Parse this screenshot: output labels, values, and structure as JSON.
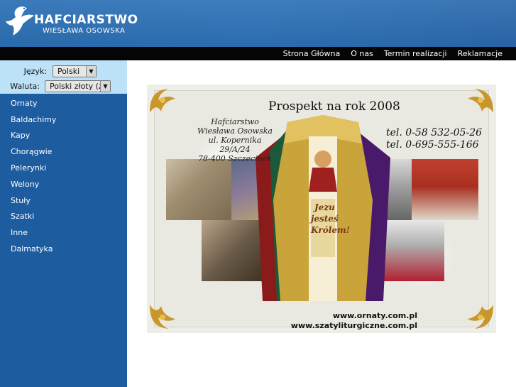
{
  "header": {
    "logo_line1": "HAFCIARSTWO",
    "logo_line2": "WIESŁAWA OSOWSKA"
  },
  "topnav": {
    "items": [
      "Strona Główna",
      "O nas",
      "Termin realizacji",
      "Reklamacje"
    ]
  },
  "controls": {
    "language_label": "Język:",
    "language_value": "Polski",
    "currency_label": "Waluta:",
    "currency_value": "Polski złoty (zł)"
  },
  "menu": {
    "items": [
      "Ornaty",
      "Baldachimy",
      "Kapy",
      "Chorągwie",
      "Pelerynki",
      "Welony",
      "Stuły",
      "Szatki",
      "Inne",
      "Dalmatyka"
    ]
  },
  "brochure": {
    "title": "Prospekt na rok 2008",
    "company_line1": "Hafciarstwo",
    "company_line2": "Wiesława Osowska",
    "company_line3": "ul. Kopernika 29/A/24",
    "company_line4": "78-400 Szczecinek",
    "phone1": "tel. 0-58 532-05-26",
    "phone2": "tel. 0-695-555-166",
    "vestment_text1": "Jezu",
    "vestment_text2": "jesteś",
    "vestment_text3": "Królem!",
    "url1": "www.ornaty.com.pl",
    "url2": "www.szatyliturgiczne.com.pl"
  },
  "colors": {
    "header_blue": "#2a6fb4",
    "sidebar_blue": "#1e5ca0",
    "controls_bg": "#bde1f7",
    "topnav_bg": "#050505"
  }
}
